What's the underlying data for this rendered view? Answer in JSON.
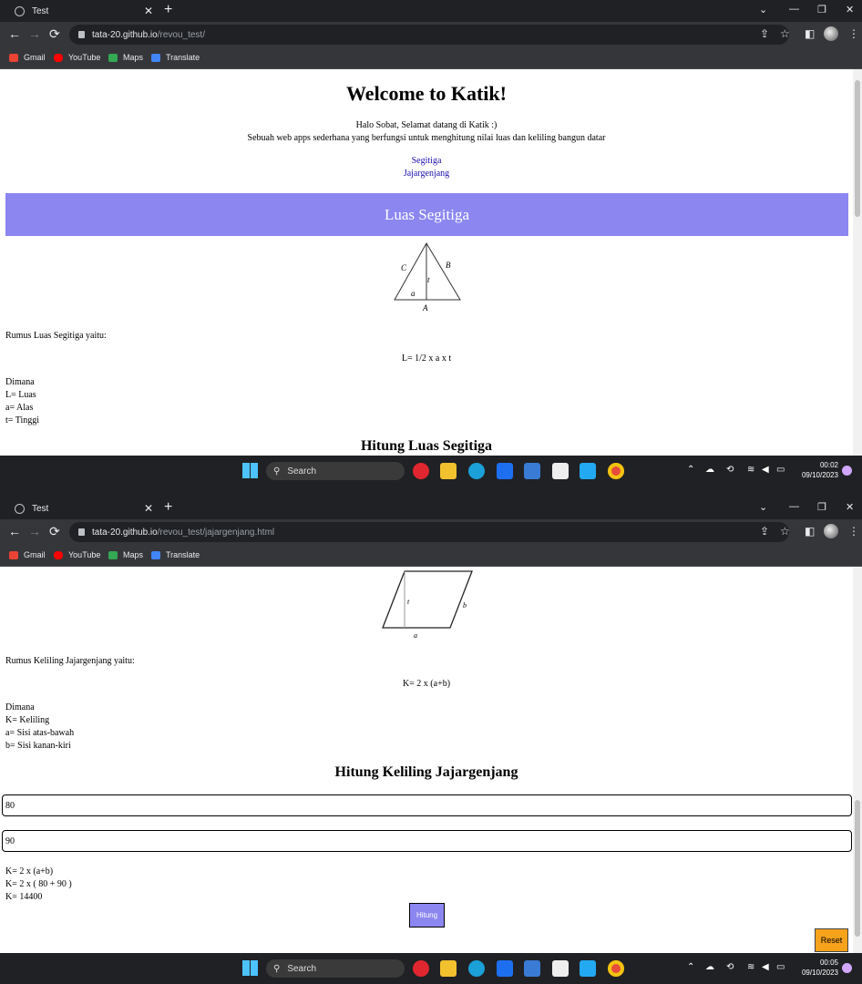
{
  "shot1": {
    "tab_title": "Test",
    "url_host": "tata-20.github.io",
    "url_path": "/revou_test/",
    "bookmarks": [
      "Gmail",
      "YouTube",
      "Maps",
      "Translate"
    ],
    "page": {
      "title": "Welcome to Katik!",
      "intro_line1": "Halo Sobat, Selamat datang di Katik :)",
      "intro_line2": "Sebuah web apps sederhana yang berfungsi untuk menghitung nilai luas dan keliling bangun datar",
      "nav_links": [
        "Segitiga",
        "Jajargenjang"
      ],
      "banner": "Luas Segitiga",
      "figure_labels": {
        "c": "C",
        "b": "B",
        "t": "t",
        "a": "a",
        "base": "A"
      },
      "rumus_label": "Rumus Luas Segitiga yaitu:",
      "formula": "L= 1/2 x a x t",
      "dimana": [
        "Dimana",
        "L= Luas",
        "a= Alas",
        "t= Tinggi"
      ],
      "section_heading": "Hitung Luas Segitiga"
    },
    "taskbar": {
      "search": "Search",
      "time": "00:02",
      "date": "09/10/2023"
    }
  },
  "shot2": {
    "tab_title": "Test",
    "url_host": "tata-20.github.io",
    "url_path": "/revou_test/jajargenjang.html",
    "bookmarks": [
      "Gmail",
      "YouTube",
      "Maps",
      "Translate"
    ],
    "page": {
      "figure_labels": {
        "t": "t",
        "b": "b",
        "a": "a"
      },
      "rumus_label": "Rumus Keliling Jajargenjang yaitu:",
      "formula": "K= 2 x (a+b)",
      "dimana": [
        "Dimana",
        "K= Keliling",
        "a= Sisi atas-bawah",
        "b= Sisi kanan-kiri"
      ],
      "section_heading": "Hitung Keliling Jajargenjang",
      "input_a": "80",
      "input_b": "90",
      "result": [
        "K= 2 x (a+b)",
        "K= 2 x ( 80 + 90 )",
        "K= 14400"
      ],
      "hitung_label": "Hitung",
      "reset_label": "Reset"
    },
    "taskbar": {
      "search": "Search",
      "time": "00:05",
      "date": "09/10/2023"
    }
  }
}
